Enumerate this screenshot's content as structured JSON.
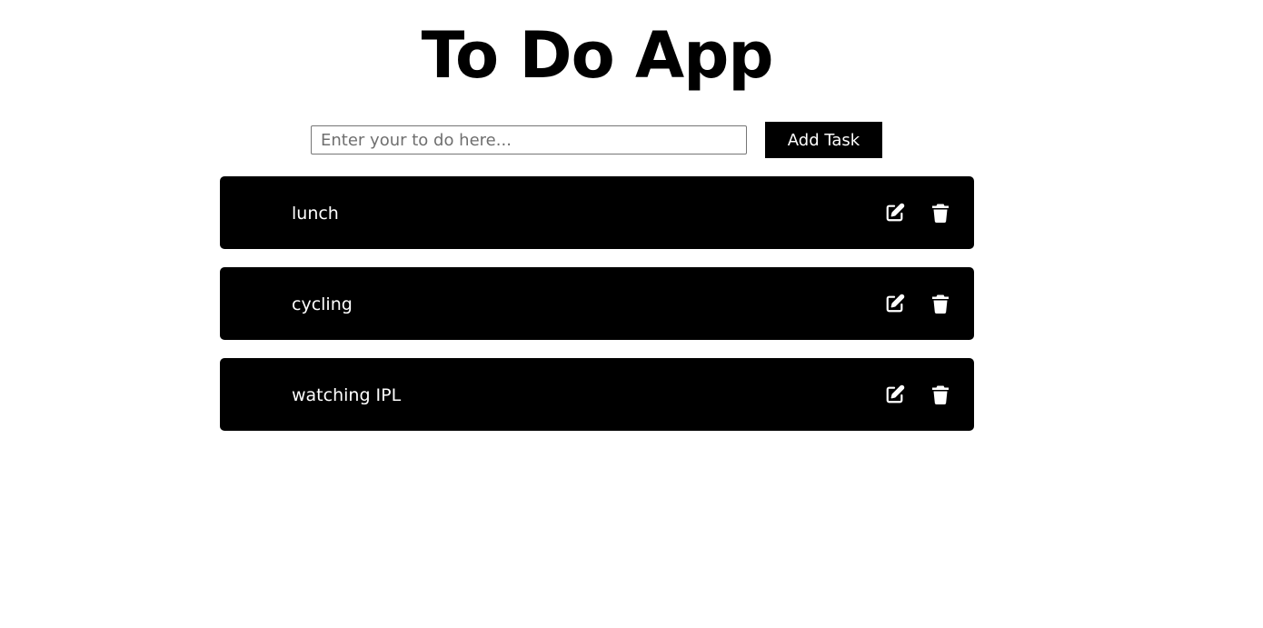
{
  "header": {
    "title": "To Do App"
  },
  "form": {
    "placeholder": "Enter your to do here...",
    "value": "",
    "add_button_label": "Add Task"
  },
  "tasks": [
    {
      "text": "lunch",
      "edit_icon": "edit-icon",
      "delete_icon": "trash-icon"
    },
    {
      "text": "cycling",
      "edit_icon": "edit-icon",
      "delete_icon": "trash-icon"
    },
    {
      "text": "watching IPL",
      "edit_icon": "edit-icon",
      "delete_icon": "trash-icon"
    }
  ],
  "colors": {
    "background": "#ffffff",
    "task_background": "#000000",
    "task_text": "#ffffff",
    "button_background": "#000000",
    "button_text": "#ffffff"
  }
}
